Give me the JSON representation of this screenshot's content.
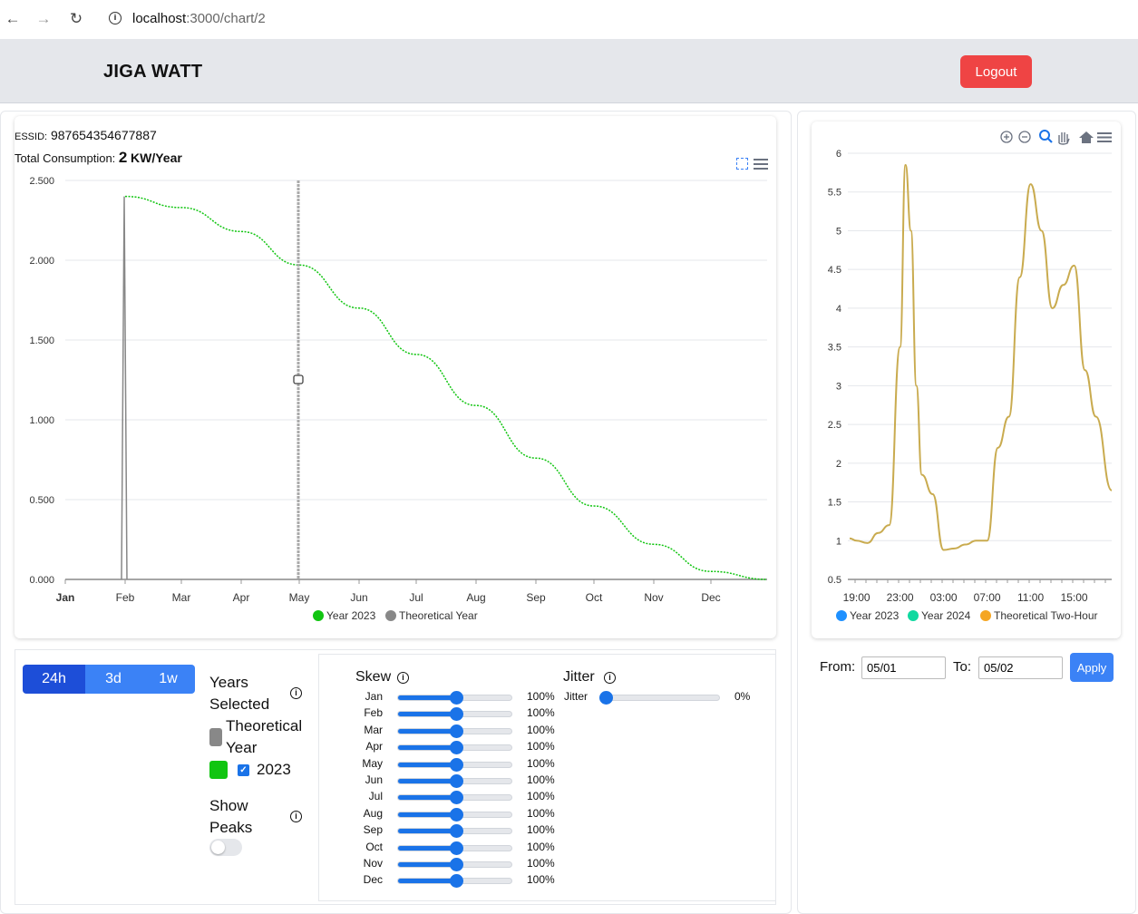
{
  "browser": {
    "url_host": "localhost",
    "url_path": ":3000/chart/2"
  },
  "header": {
    "brand": "JIGA WATT",
    "logout_label": "Logout"
  },
  "info": {
    "essid_label": "ESSID:",
    "essid_value": "987654354677887",
    "total_label": "Total Consumption:",
    "total_value": "2",
    "total_unit": "KW/Year"
  },
  "controls": {
    "ranges": [
      {
        "label": "24h",
        "active": true
      },
      {
        "label": "3d",
        "active": false
      },
      {
        "label": "1w",
        "active": false
      }
    ],
    "years_selected_label": "Years Selected",
    "legend_theoretical": "Theoretical Year",
    "legend_2023": "2023",
    "show_peaks_label": "Show Peaks",
    "skew_title": "Skew",
    "jitter_title": "Jitter",
    "skew": [
      {
        "month": "Jan",
        "value": "100%",
        "fraction": 0.5
      },
      {
        "month": "Feb",
        "value": "100%",
        "fraction": 0.5
      },
      {
        "month": "Mar",
        "value": "100%",
        "fraction": 0.5
      },
      {
        "month": "Apr",
        "value": "100%",
        "fraction": 0.5
      },
      {
        "month": "May",
        "value": "100%",
        "fraction": 0.5
      },
      {
        "month": "Jun",
        "value": "100%",
        "fraction": 0.5
      },
      {
        "month": "Jul",
        "value": "100%",
        "fraction": 0.5
      },
      {
        "month": "Aug",
        "value": "100%",
        "fraction": 0.5
      },
      {
        "month": "Sep",
        "value": "100%",
        "fraction": 0.5
      },
      {
        "month": "Oct",
        "value": "100%",
        "fraction": 0.5
      },
      {
        "month": "Nov",
        "value": "100%",
        "fraction": 0.5
      },
      {
        "month": "Dec",
        "value": "100%",
        "fraction": 0.5
      }
    ],
    "jitter": {
      "label": "Jitter",
      "value": "0%",
      "fraction": 0.0
    }
  },
  "date_filter": {
    "from_label": "From:",
    "from_value": "05/01",
    "to_label": "To:",
    "to_value": "05/02",
    "apply_label": "Apply"
  },
  "colors": {
    "year_2023": "#11c511",
    "theoretical_year": "#888888",
    "year_2024": "#10d9a0",
    "theoretical_two_hour": "#f5a623",
    "accent": "#3b82f6",
    "logout": "#ef4444"
  },
  "chart_data": [
    {
      "type": "line",
      "ylim": [
        0,
        2.5
      ],
      "y_ticks": [
        "0.000",
        "0.500",
        "1.000",
        "1.500",
        "2.000",
        "2.500"
      ],
      "categories": [
        "Jan",
        "Feb",
        "Mar",
        "Apr",
        "May",
        "Jun",
        "Jul",
        "Aug",
        "Sep",
        "Oct",
        "Nov",
        "Dec"
      ],
      "series": [
        {
          "name": "Year 2023",
          "x": [
            "Feb",
            "Mar",
            "Apr",
            "May",
            "Jun",
            "Jul",
            "Aug",
            "Sep",
            "Oct",
            "Nov",
            "Dec",
            "Dec end"
          ],
          "values": [
            2.4,
            2.33,
            2.18,
            1.97,
            1.7,
            1.41,
            1.09,
            0.76,
            0.46,
            0.22,
            0.05,
            0.0
          ]
        },
        {
          "name": "Theoretical Year",
          "x": [
            "Jan",
            "Feb",
            "Feb",
            "Feb",
            "Dec end"
          ],
          "values": [
            0,
            0,
            2.4,
            0,
            0
          ]
        }
      ],
      "grid": true,
      "legend": "bottom"
    },
    {
      "type": "line",
      "ylim": [
        0.5,
        6
      ],
      "y_ticks": [
        "0.5",
        "1",
        "1.5",
        "2",
        "2.5",
        "3",
        "3.5",
        "4",
        "4.5",
        "5",
        "5.5",
        "6"
      ],
      "x_ticks": [
        "19:00",
        "23:00",
        "03:00",
        "07:00",
        "11:00",
        "15:00"
      ],
      "series": [
        {
          "name": "Year 2023",
          "values": []
        },
        {
          "name": "Year 2024",
          "values": []
        },
        {
          "name": "Theoretical Two-Hour",
          "x": [
            "18:00",
            "19:00",
            "20:00",
            "21:00",
            "22:00",
            "23:00",
            "23:30",
            "00:00",
            "00:30",
            "01:00",
            "02:00",
            "03:00",
            "04:00",
            "05:00",
            "06:00",
            "07:00",
            "08:00",
            "09:00",
            "10:00",
            "11:00",
            "12:00",
            "13:00",
            "14:00",
            "15:00",
            "16:00",
            "17:00",
            "18:00"
          ],
          "values": [
            1.03,
            1.0,
            0.97,
            1.1,
            1.2,
            3.5,
            5.85,
            5.0,
            3.0,
            1.85,
            1.6,
            0.88,
            0.9,
            0.95,
            1.0,
            1.0,
            2.2,
            2.6,
            4.4,
            5.6,
            5.0,
            4.0,
            4.3,
            4.55,
            3.2,
            2.6,
            1.65
          ]
        }
      ],
      "grid": true,
      "legend": "bottom"
    }
  ]
}
